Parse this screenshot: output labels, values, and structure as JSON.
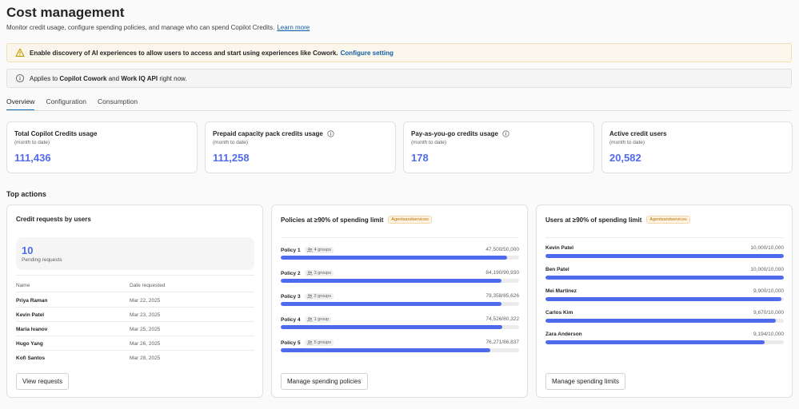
{
  "header": {
    "title": "Cost management",
    "subtitle": "Monitor credit usage, configure spending policies, and manage who can spend Copilot Credits.",
    "learn_more": "Learn more"
  },
  "banners": {
    "warning": {
      "text": "Enable discovery of AI experiences to allow users to access and start using experiences like Cowork.",
      "link": "Configure setting",
      "icon": "warning-icon"
    },
    "info": {
      "prefix": "Applies to",
      "item1": "Copilot Cowork",
      "joiner": "and",
      "item2": "Work IQ API",
      "suffix": "right now.",
      "icon": "info-icon"
    }
  },
  "tabs": [
    {
      "label": "Overview",
      "active": true
    },
    {
      "label": "Configuration",
      "active": false
    },
    {
      "label": "Consumption",
      "active": false
    }
  ],
  "metrics": [
    {
      "label": "Total Copilot Credits usage",
      "sub": "(month to date)",
      "value": "111,436",
      "info": false
    },
    {
      "label": "Prepaid capacity pack credits usage",
      "sub": "(month to date)",
      "value": "111,258",
      "info": true
    },
    {
      "label": "Pay-as-you-go credits usage",
      "sub": "(month to date)",
      "value": "178",
      "info": true
    },
    {
      "label": "Active credit users",
      "sub": "(month to date)",
      "value": "20,582",
      "info": false
    }
  ],
  "top_actions": {
    "title": "Top actions",
    "credit_requests": {
      "title": "Credit requests by users",
      "pending_count": "10",
      "pending_label": "Pending requests",
      "col_name": "Name",
      "col_date": "Date requested",
      "rows": [
        {
          "name": "Priya Raman",
          "date": "Mar 22, 2025"
        },
        {
          "name": "Kevin Patel",
          "date": "Mar 23, 2025"
        },
        {
          "name": "Maria Ivanov",
          "date": "Mar 25, 2025"
        },
        {
          "name": "Hugo Yang",
          "date": "Mar 26, 2025"
        },
        {
          "name": "Kofi Santos",
          "date": "Mar 28, 2025"
        }
      ],
      "button": "View requests"
    },
    "policies": {
      "title": "Policies at ≥90% of spending limit",
      "tag": "Agentsandservices",
      "rows": [
        {
          "name": "Policy 1",
          "groups": "4 groups",
          "value": "47,500/50,000",
          "fraction": 0.95
        },
        {
          "name": "Policy 2",
          "groups": "3 groups",
          "value": "84,190/90,930",
          "fraction": 0.926
        },
        {
          "name": "Policy 3",
          "groups": "2 groups",
          "value": "79,358/85,626",
          "fraction": 0.927
        },
        {
          "name": "Policy 4",
          "groups": "1 group",
          "value": "74,526/80,322",
          "fraction": 0.928
        },
        {
          "name": "Policy 5",
          "groups": "5 groups",
          "value": "76,271/86,837",
          "fraction": 0.878
        }
      ],
      "button": "Manage spending policies"
    },
    "users": {
      "title": "Users at ≥90% of spending limit",
      "tag": "Agentsandservices",
      "rows": [
        {
          "name": "Kevin Patel",
          "value": "10,000/10,000",
          "fraction": 1.0
        },
        {
          "name": "Ben Patel",
          "value": "10,000/10,000",
          "fraction": 1.0
        },
        {
          "name": "Mei Martinez",
          "value": "9,900/10,000",
          "fraction": 0.99
        },
        {
          "name": "Carlos Kim",
          "value": "9,670/10,000",
          "fraction": 0.967
        },
        {
          "name": "Zara Anderson",
          "value": "9,194/10,000",
          "fraction": 0.919
        }
      ],
      "button": "Manage spending limits"
    }
  },
  "colors": {
    "accent": "#4f6bed",
    "link": "#115ea3",
    "warning": "#c19c00",
    "tag": "#bc6b00"
  }
}
